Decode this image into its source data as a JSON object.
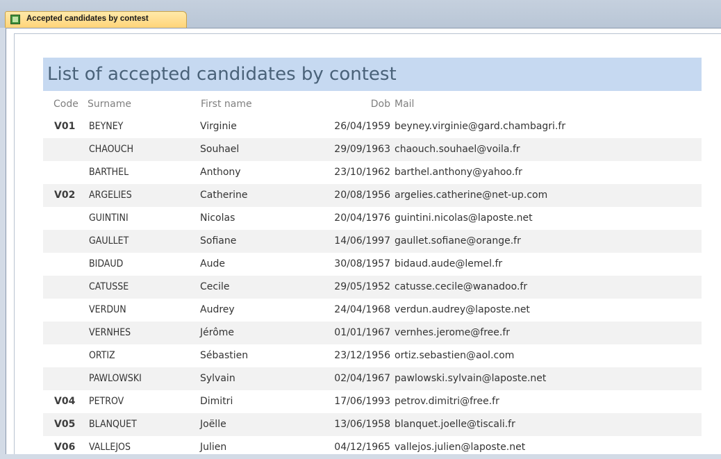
{
  "tab": {
    "label": "Accepted candidates by contest",
    "icon": "report-icon"
  },
  "report": {
    "title": "List of accepted candidates by contest",
    "headers": {
      "code": "Code",
      "surname": "Surname",
      "first_name": "First name",
      "dob": "Dob",
      "mail": "Mail"
    },
    "rows": [
      {
        "code": "V01",
        "surname": "BEYNEY",
        "first_name": "Virginie",
        "dob": "26/04/1959",
        "mail": "beyney.virginie@gard.chambagri.fr"
      },
      {
        "code": "",
        "surname": "CHAOUCH",
        "first_name": "Souhael",
        "dob": "29/09/1963",
        "mail": "chaouch.souhael@voila.fr"
      },
      {
        "code": "",
        "surname": "BARTHEL",
        "first_name": "Anthony",
        "dob": "23/10/1962",
        "mail": "barthel.anthony@yahoo.fr"
      },
      {
        "code": "V02",
        "surname": "ARGELIES",
        "first_name": "Catherine",
        "dob": "20/08/1956",
        "mail": "argelies.catherine@net-up.com"
      },
      {
        "code": "",
        "surname": "GUINTINI",
        "first_name": "Nicolas",
        "dob": "20/04/1976",
        "mail": "guintini.nicolas@laposte.net"
      },
      {
        "code": "",
        "surname": "GAULLET",
        "first_name": "Sofiane",
        "dob": "14/06/1997",
        "mail": "gaullet.sofiane@orange.fr"
      },
      {
        "code": "",
        "surname": "BIDAUD",
        "first_name": "Aude",
        "dob": "30/08/1957",
        "mail": "bidaud.aude@lemel.fr"
      },
      {
        "code": "",
        "surname": "CATUSSE",
        "first_name": "Cecile",
        "dob": "29/05/1952",
        "mail": "catusse.cecile@wanadoo.fr"
      },
      {
        "code": "",
        "surname": "VERDUN",
        "first_name": "Audrey",
        "dob": "24/04/1968",
        "mail": "verdun.audrey@laposte.net"
      },
      {
        "code": "",
        "surname": "VERNHES",
        "first_name": "Jérôme",
        "dob": "01/01/1967",
        "mail": "vernhes.jerome@free.fr"
      },
      {
        "code": "",
        "surname": "ORTIZ",
        "first_name": "Sébastien",
        "dob": "23/12/1956",
        "mail": "ortiz.sebastien@aol.com"
      },
      {
        "code": "",
        "surname": "PAWLOWSKI",
        "first_name": "Sylvain",
        "dob": "02/04/1967",
        "mail": "pawlowski.sylvain@laposte.net"
      },
      {
        "code": "V04",
        "surname": "PETROV",
        "first_name": "Dimitri",
        "dob": "17/06/1993",
        "mail": "petrov.dimitri@free.fr"
      },
      {
        "code": "V05",
        "surname": "BLANQUET",
        "first_name": "Joëlle",
        "dob": "13/06/1958",
        "mail": "blanquet.joelle@tiscali.fr"
      },
      {
        "code": "V06",
        "surname": "VALLEJOS",
        "first_name": "Julien",
        "dob": "04/12/1965",
        "mail": "vallejos.julien@laposte.net"
      }
    ]
  }
}
